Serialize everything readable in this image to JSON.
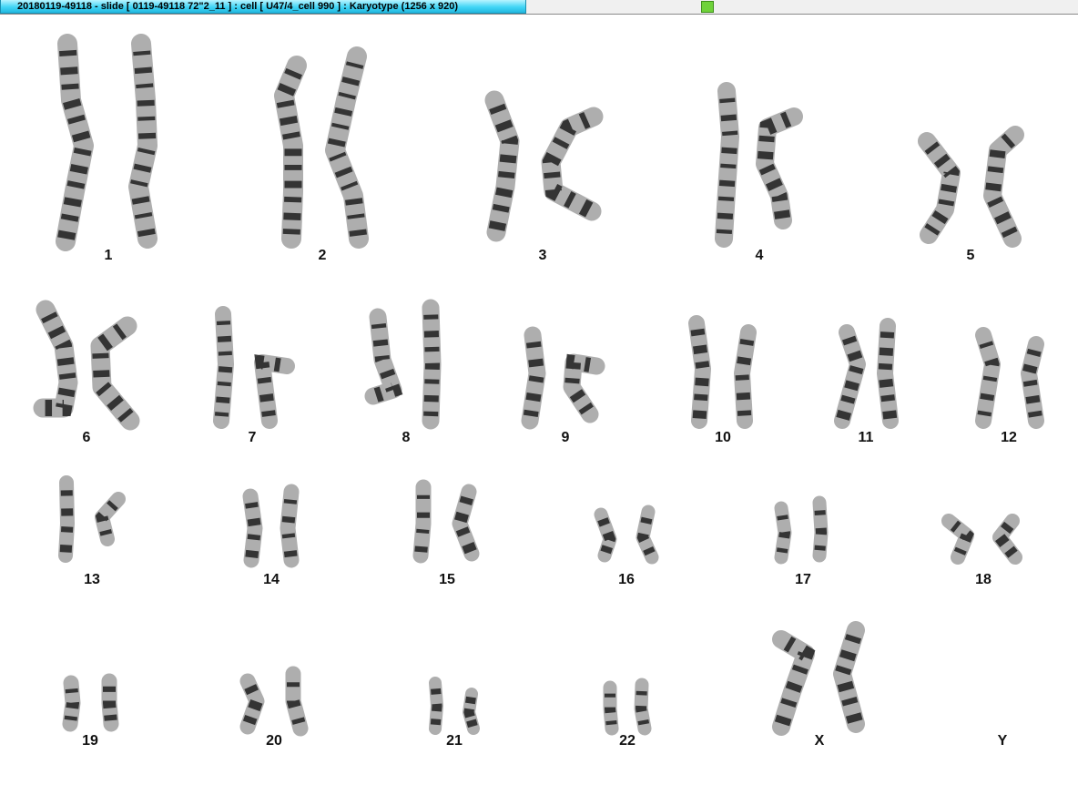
{
  "window": {
    "title": "20180119-49118 - slide [ 0119-49118 72\"2_11 ] : cell [ U47/4_cell 990 ] : Karyotype  (1256 x 920)",
    "status_led_color": "#6fd23a"
  },
  "karyotype": {
    "chromosome_color": "#6b6b6b",
    "band_color": "#1e1e1e",
    "labels": [
      "1",
      "2",
      "3",
      "4",
      "5",
      "6",
      "7",
      "8",
      "9",
      "10",
      "11",
      "12",
      "13",
      "14",
      "15",
      "16",
      "17",
      "18",
      "19",
      "20",
      "21",
      "22",
      "X",
      "Y"
    ]
  }
}
